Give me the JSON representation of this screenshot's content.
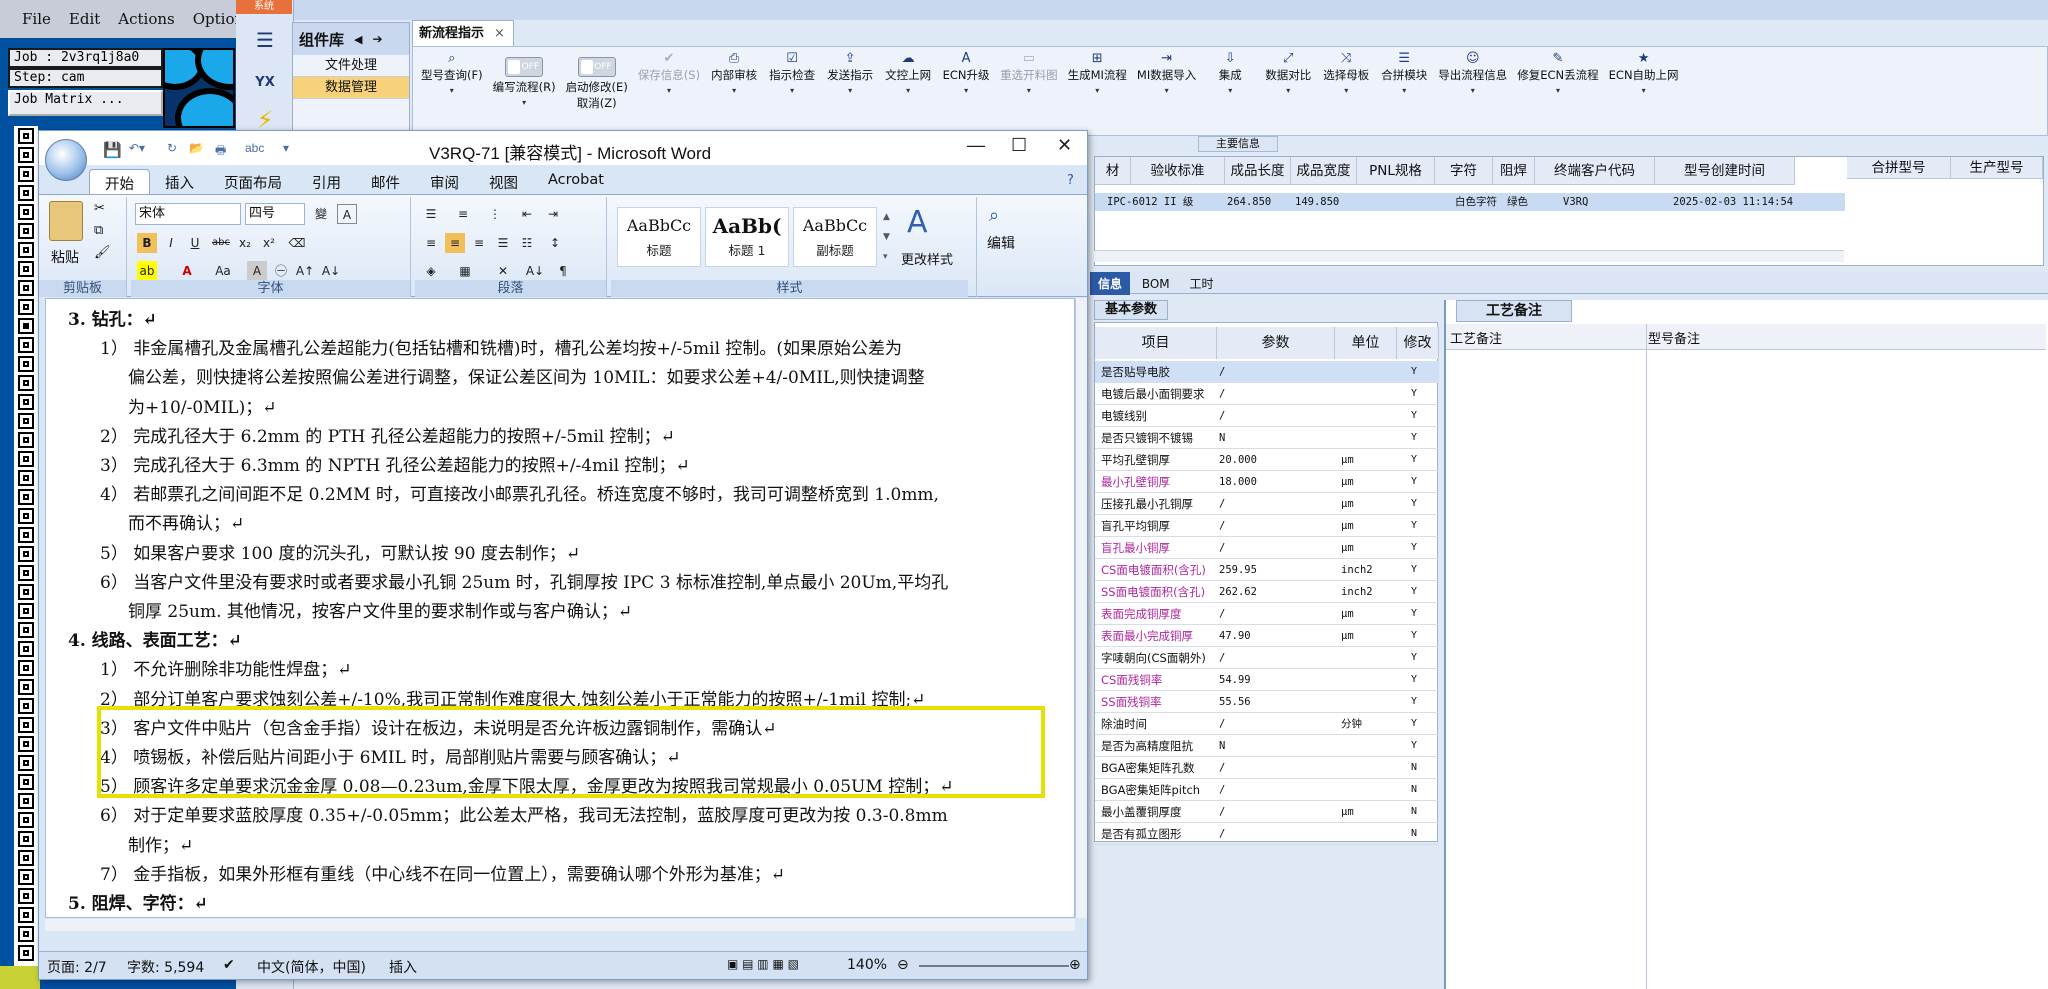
{
  "cam": {
    "menu": [
      "File",
      "Edit",
      "Actions",
      "Options"
    ],
    "job": "Job : 2v3rq1j8a0",
    "step": "Step: cam",
    "job_matrix": "Job Matrix ..."
  },
  "mes": {
    "system_tab": "系统",
    "component_lib": "组件库",
    "lib_items": [
      "文件处理",
      "数据管理"
    ],
    "flow_tab": "新流程指示",
    "ribbon": [
      {
        "label": "型号查询(F)",
        "icon": "⌕",
        "enabled": true
      },
      {
        "label": "编写流程(R)",
        "icon": "toggle",
        "enabled": true,
        "toggle": "OFF"
      },
      {
        "label": "启动修改(E)",
        "icon": "toggle",
        "enabled": true,
        "toggle": "OFF",
        "sub": "取消(Z)"
      },
      {
        "label": "保存信息(S)",
        "icon": "✔",
        "enabled": false
      },
      {
        "label": "内部审核",
        "icon": "⎙",
        "enabled": true
      },
      {
        "label": "指示检查",
        "icon": "☑",
        "enabled": true
      },
      {
        "label": "发送指示",
        "icon": "⇪",
        "enabled": true
      },
      {
        "label": "文控上网",
        "icon": "☁",
        "enabled": true
      },
      {
        "label": "ECN升级",
        "icon": "A",
        "enabled": true
      },
      {
        "label": "重选开料图",
        "icon": "▭",
        "enabled": false
      },
      {
        "label": "生成MI流程",
        "icon": "⊞",
        "enabled": true
      },
      {
        "label": "MI数据导入",
        "icon": "⇥",
        "enabled": true
      },
      {
        "label": "集成",
        "icon": "⇩",
        "enabled": true
      },
      {
        "label": "数据对比",
        "icon": "⤢",
        "enabled": true
      },
      {
        "label": "选择母板",
        "icon": "⤨",
        "enabled": true
      },
      {
        "label": "合拼模块",
        "icon": "☰",
        "enabled": true
      },
      {
        "label": "导出流程信息",
        "icon": "☺",
        "enabled": true
      },
      {
        "label": "修复ECN丢流程",
        "icon": "✎",
        "enabled": true
      },
      {
        "label": "ECN自助上网",
        "icon": "★",
        "enabled": true
      }
    ],
    "main_info_label": "主要信息",
    "grid_headers": [
      "材",
      "验收标准",
      "成品长度",
      "成品宽度",
      "PNL规格",
      "字符",
      "阻焊",
      "终端客户代码",
      "型号创建时间"
    ],
    "grid_row": [
      "",
      "IPC-6012 II 级",
      "264.850",
      "149.850",
      "",
      "白色字符",
      "绿色",
      "V3RQ",
      "2025-02-03 11:14:54"
    ],
    "grid2_headers": [
      "合拼型号",
      "生产型号"
    ],
    "sub_tabs": [
      "信息",
      "BOM",
      "工时"
    ],
    "basic_params_tab": "基本参数",
    "param_headers": [
      "项目",
      "参数",
      "单位",
      "修改"
    ],
    "params": [
      {
        "item": "是否贴导电胶",
        "value": "/",
        "unit": "",
        "mod": "Y",
        "pink": false,
        "sel": true
      },
      {
        "item": "电镀后最小面铜要求",
        "value": "/",
        "unit": "",
        "mod": "Y",
        "pink": false
      },
      {
        "item": "电镀线别",
        "value": "/",
        "unit": "",
        "mod": "Y",
        "pink": false
      },
      {
        "item": "是否只镀铜不镀锡",
        "value": "N",
        "unit": "",
        "mod": "Y",
        "pink": false
      },
      {
        "item": "平均孔壁铜厚",
        "value": "20.000",
        "unit": "μm",
        "mod": "Y",
        "pink": false
      },
      {
        "item": "最小孔壁铜厚",
        "value": "18.000",
        "unit": "μm",
        "mod": "Y",
        "pink": true
      },
      {
        "item": "压接孔最小孔铜厚",
        "value": "/",
        "unit": "μm",
        "mod": "Y",
        "pink": false
      },
      {
        "item": "盲孔平均铜厚",
        "value": "/",
        "unit": "μm",
        "mod": "Y",
        "pink": false
      },
      {
        "item": "盲孔最小铜厚",
        "value": "/",
        "unit": "μm",
        "mod": "Y",
        "pink": true
      },
      {
        "item": "CS面电镀面积(含孔)",
        "value": "259.95",
        "unit": "inch2",
        "mod": "Y",
        "pink": true
      },
      {
        "item": "SS面电镀面积(含孔)",
        "value": "262.62",
        "unit": "inch2",
        "mod": "Y",
        "pink": true
      },
      {
        "item": "表面完成铜厚度",
        "value": "/",
        "unit": "μm",
        "mod": "Y",
        "pink": true
      },
      {
        "item": "表面最小完成铜厚",
        "value": "47.90",
        "unit": "μm",
        "mod": "Y",
        "pink": true
      },
      {
        "item": "字唛朝向(CS面朝外)",
        "value": "/",
        "unit": "",
        "mod": "Y",
        "pink": false
      },
      {
        "item": "CS面残铜率",
        "value": "54.99",
        "unit": "",
        "mod": "Y",
        "pink": true
      },
      {
        "item": "SS面残铜率",
        "value": "55.56",
        "unit": "",
        "mod": "Y",
        "pink": true
      },
      {
        "item": "除油时间",
        "value": "/",
        "unit": "分钟",
        "mod": "Y",
        "pink": false
      },
      {
        "item": "是否为高精度阻抗",
        "value": "N",
        "unit": "",
        "mod": "Y",
        "pink": false
      },
      {
        "item": "BGA密集矩阵孔数",
        "value": "/",
        "unit": "",
        "mod": "N",
        "pink": false
      },
      {
        "item": "BGA密集矩阵pitch",
        "value": "/",
        "unit": "",
        "mod": "N",
        "pink": false
      },
      {
        "item": "最小盖覆铜厚度",
        "value": "/",
        "unit": "μm",
        "mod": "N",
        "pink": false
      },
      {
        "item": "是否有孤立图形",
        "value": "/",
        "unit": "",
        "mod": "N",
        "pink": false
      }
    ],
    "craft_tab": "工艺备注",
    "craft_headers": [
      "工艺备注",
      "型号备注"
    ]
  },
  "word": {
    "title": "V3RQ-71 [兼容模式] - Microsoft Word",
    "tabs": [
      "开始",
      "插入",
      "页面布局",
      "引用",
      "邮件",
      "审阅",
      "视图",
      "Acrobat"
    ],
    "font_name": "宋体",
    "font_size": "四号",
    "paste": "粘贴",
    "groups": [
      "剪贴板",
      "字体",
      "段落",
      "样式"
    ],
    "styles": [
      {
        "sample": "AaBbCc",
        "name": "标题"
      },
      {
        "sample": "AaBb(",
        "name": "标题 1"
      },
      {
        "sample": "AaBbCc",
        "name": "副标题"
      }
    ],
    "change_styles": "更改样式",
    "edit": "编辑",
    "lines": [
      {
        "t": "3.   钻孔：↵"
      },
      {
        "t": "1）  非金属槽孔及金属槽孔公差超能力(包括钻槽和铣槽)时，槽孔公差均按+/-5mil 控制。(如果原始公差为"
      },
      {
        "t": "偏公差，则快捷将公差按照偏公差进行调整，保证公差区间为 10MIL：如要求公差+4/-0MIL,则快捷调整"
      },
      {
        "t": "为+10/-0MIL)；↵"
      },
      {
        "t": "2）  完成孔径大于 6.2mm 的 PTH 孔径公差超能力的按照+/-5mil 控制；↵"
      },
      {
        "t": "3）  完成孔径大于 6.3mm 的 NPTH 孔径公差超能力的按照+/-4mil 控制；↵"
      },
      {
        "t": "4）  若邮票孔之间间距不足 0.2MM 时，可直接改小邮票孔孔径。桥连宽度不够时，我司可调整桥宽到 1.0mm,"
      },
      {
        "t": "而不再确认；↵"
      },
      {
        "t": "5）  如果客户要求 100 度的沉头孔，可默认按 90 度去制作；↵"
      },
      {
        "t": "6）  当客户文件里没有要求时或者要求最小孔铜 25um 时，孔铜厚按 IPC 3 标标准控制,单点最小 20Um,平均孔"
      },
      {
        "t": "铜厚 25um. 其他情况，按客户文件里的要求制作或与客户确认；↵"
      },
      {
        "t": "4.   线路、表面工艺：↵"
      },
      {
        "t": "1）  不允许删除非功能性焊盘；↵"
      },
      {
        "t": "2）  部分订单客户要求蚀刻公差+/-10%,我司正常制作难度很大,蚀刻公差小于正常能力的按照+/-1mil 控制;↵"
      },
      {
        "t": "3）  客户文件中贴片（包含金手指）设计在板边，未说明是否允许板边露铜制作，需确认↵"
      },
      {
        "t": "4）  喷锡板，补偿后贴片间距小于 6MIL 时，局部削贴片需要与顾客确认；↵"
      },
      {
        "t": "5）  顾客许多定单要求沉金金厚 0.08—0.23um,金厚下限太厚，金厚更改为按照我司常规最小 0.05UM 控制；↵"
      },
      {
        "t": "6）  对于定单要求蓝胶厚度 0.35+/-0.05mm；此公差太严格，我司无法控制，蓝胶厚度可更改为按 0.3-0.8mm"
      },
      {
        "t": "制作；↵"
      },
      {
        "t": "7）  金手指板，如果外形框有重线（中心线不在同一位置上），需要确认哪个外形为基准；↵"
      },
      {
        "t": "5.   阻焊、字符：↵"
      }
    ],
    "status": {
      "page": "页面: 2/7",
      "words": "字数: 5,594",
      "lang": "中文(简体，中国)",
      "mode": "插入",
      "zoom": "140%"
    }
  }
}
